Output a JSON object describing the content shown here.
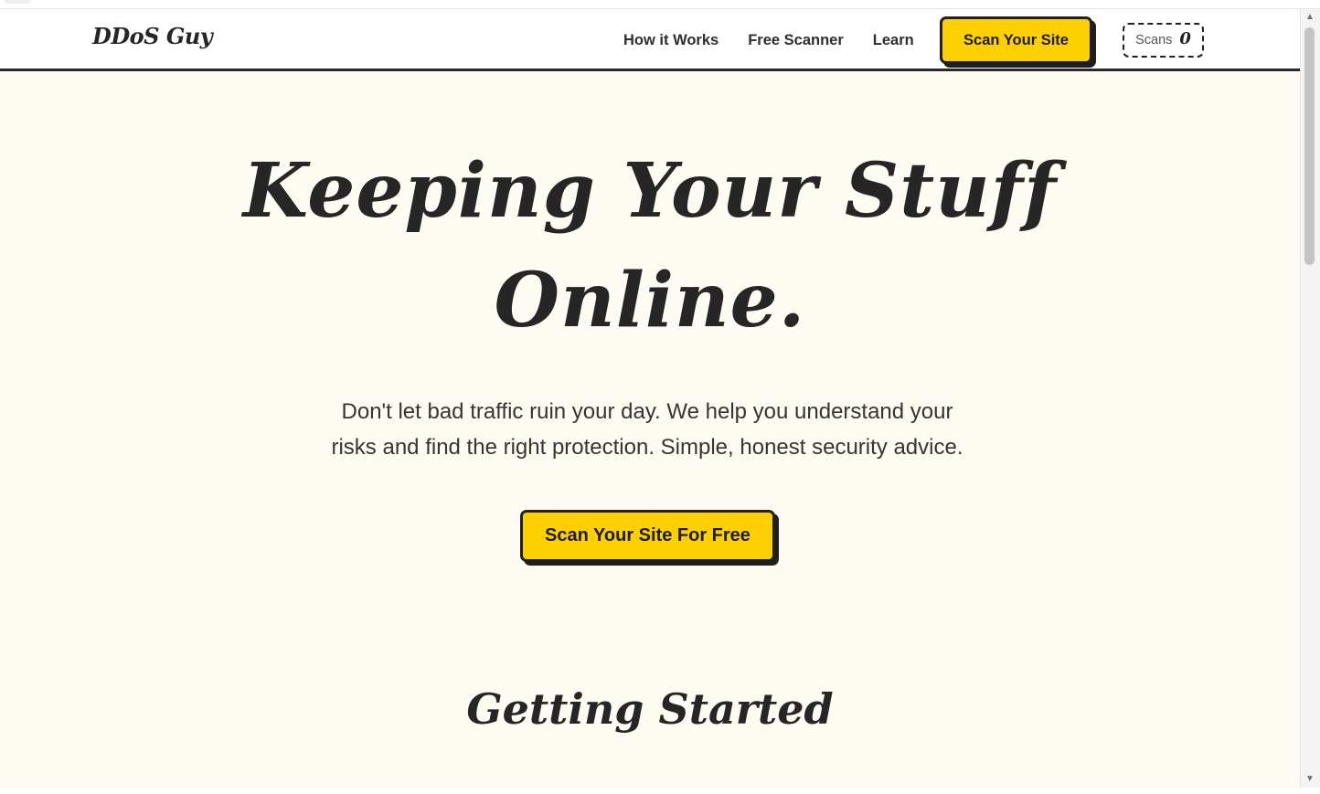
{
  "header": {
    "logo": "DDoS Guy",
    "nav": [
      "How it Works",
      "Free Scanner",
      "Learn"
    ],
    "cta_label": "Scan Your Site",
    "scans_label": "Scans",
    "scans_count": "0"
  },
  "hero": {
    "title_line1": "Keeping Your Stuff",
    "title_line2": "Online.",
    "subtitle_line1": "Don't let bad traffic ruin your day. We help you understand your",
    "subtitle_line2": "risks and find the right protection. Simple, honest security advice.",
    "cta_label": "Scan Your Site For Free"
  },
  "sections": {
    "getting_started_title": "Getting Started"
  },
  "colors": {
    "accent": "#fdd004",
    "background": "#fdfbf2",
    "text": "#262626"
  }
}
